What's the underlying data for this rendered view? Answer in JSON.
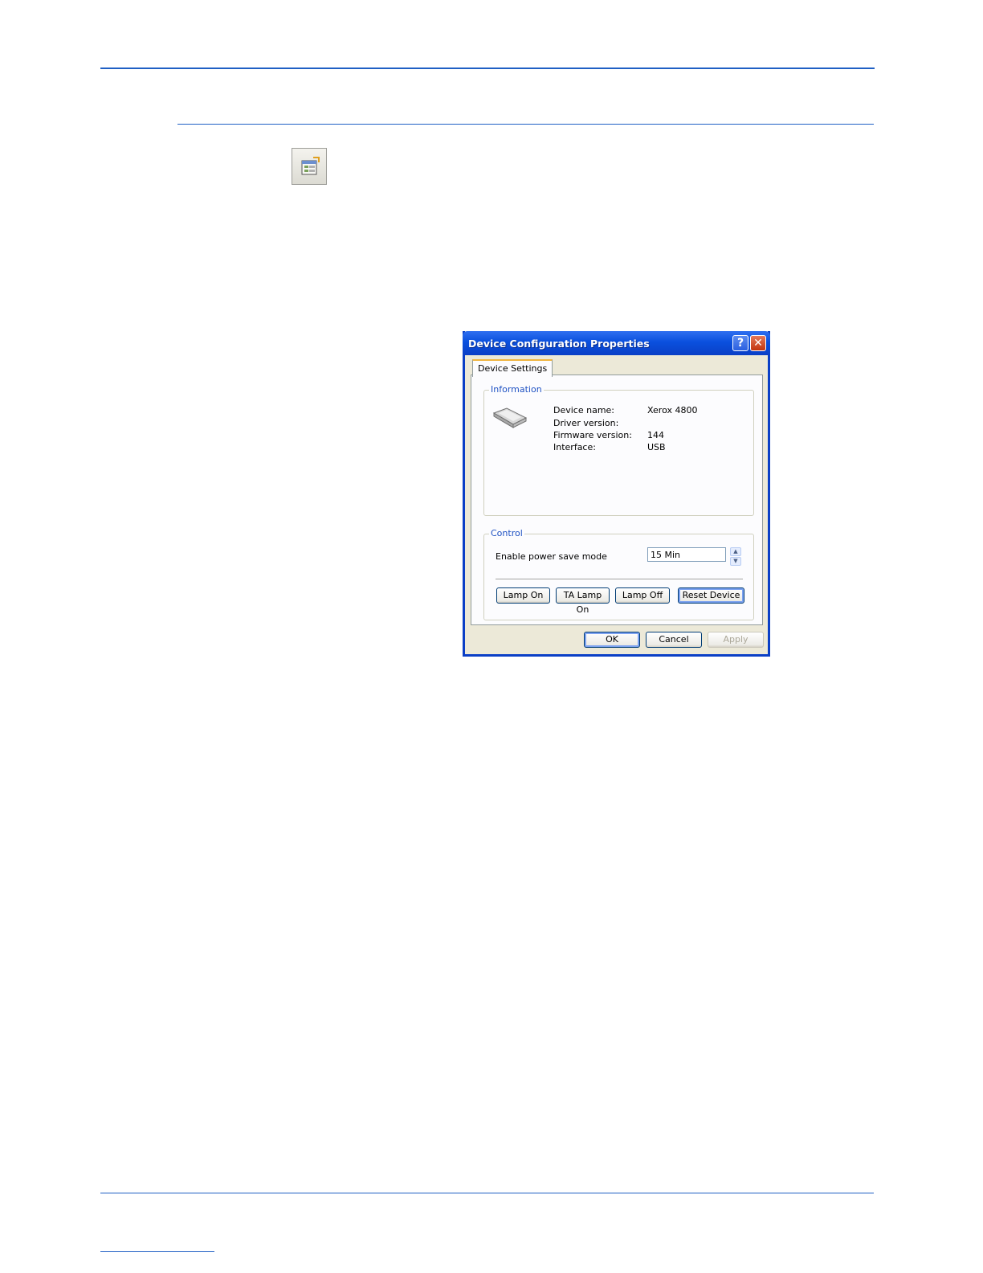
{
  "dialog": {
    "title": "Device Configuration Properties",
    "help_glyph": "?",
    "close_glyph": "✕",
    "tab_label": "Device Settings",
    "information": {
      "group_title": "Information",
      "rows": [
        {
          "label": "Device name:",
          "value": "Xerox 4800"
        },
        {
          "label": "Driver version:",
          "value": ""
        },
        {
          "label": "Firmware version:",
          "value": "144"
        },
        {
          "label": "Interface:",
          "value": "USB"
        }
      ]
    },
    "control": {
      "group_title": "Control",
      "power_save_label": "Enable power save mode",
      "power_save_value": "15 Min",
      "spin_up": "▲",
      "spin_down": "▼",
      "buttons": [
        "Lamp On",
        "TA Lamp On",
        "Lamp Off",
        "Reset Device"
      ]
    },
    "footer_buttons": {
      "ok": "OK",
      "cancel": "Cancel",
      "apply": "Apply"
    }
  },
  "icons": {
    "toolbar": "properties-icon",
    "device": "scanner-icon"
  },
  "colors": {
    "rule": "#1f5fc4",
    "titlebar": "#0a50de",
    "dialog_bg": "#ece9d8",
    "group_title": "#1f52c3"
  }
}
